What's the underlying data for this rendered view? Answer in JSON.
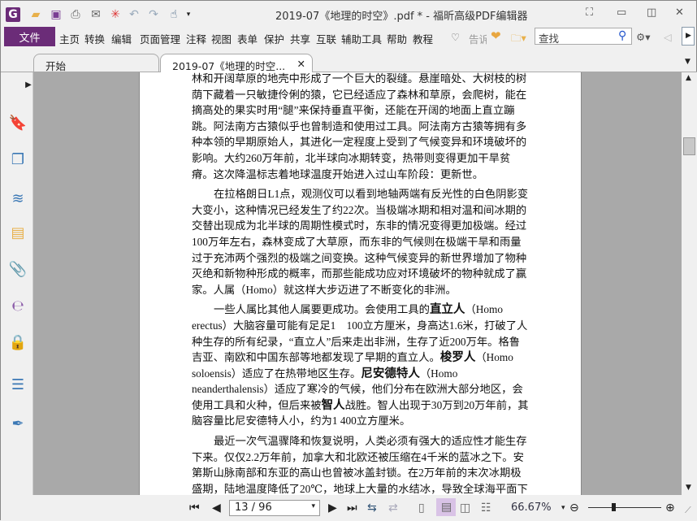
{
  "window": {
    "title": "2019-07《地理的时空》.pdf * - 福昕高级PDF编辑器"
  },
  "menu": {
    "file": "文件",
    "items": [
      "主页",
      "转换",
      "编辑",
      "页面管理",
      "注释",
      "视图",
      "表单",
      "保护",
      "共享",
      "互联",
      "辅助工具",
      "帮助",
      "教程"
    ],
    "tell": "告诉",
    "search_placeholder": "查找"
  },
  "tabs": [
    {
      "label": "开始"
    },
    {
      "label": "2019-07《地理的时空..."
    }
  ],
  "document": {
    "paragraphs": [
      {
        "indent": false,
        "lines": [
          [
            {
              "t": "林和开阔草原的地壳中形成了一个巨大的裂缝。悬崖暗处、大树枝的树"
            }
          ],
          [
            {
              "t": "荫下藏着一只敏捷伶俐的猿，它已经适应了森林和草原，会爬树，能在"
            }
          ],
          [
            {
              "t": "摘高处的果实时用“腿”来保持垂直平衡，还能在开阔的地面上直立蹦"
            }
          ],
          [
            {
              "t": "跳。阿法南方古猿似乎也曾制造和使用过工具。阿法南方古猿等拥有多"
            }
          ],
          [
            {
              "t": "种本领的早期原始人，其进化一定程度上受到了气候变异和环境破坏的"
            }
          ],
          [
            {
              "t": "影响。大约260万年前，北半球向冰期转变，热带则变得更加干旱贫"
            }
          ],
          [
            {
              "t": "瘠。这次降温标志着地球温度开始进入过山车阶段：更新世。"
            }
          ]
        ]
      },
      {
        "indent": true,
        "lines": [
          [
            {
              "t": "在拉格朗日L1点，观测仪可以看到地轴两端有反光性的白色阴影变"
            }
          ],
          [
            {
              "t": "大变小，这种情况已经发生了约22次。当极端冰期和相对温和间冰期的"
            }
          ],
          [
            {
              "t": "交替出现成为北半球的周期性模式时，东非的情况变得更加极端。经过"
            }
          ],
          [
            {
              "t": "100万年左右，森林变成了大草原，而东非的气候则在极端干旱和雨量"
            }
          ],
          [
            {
              "t": "过于充沛两个强烈的极端之间变换。这种气候变异的新世界增加了物种"
            }
          ],
          [
            {
              "t": "灭绝和新物种形成的概率，而那些能成功应对环境破坏的物种就成了赢"
            }
          ],
          [
            {
              "t": "家。人属（Homo）就这样大步迈进了不断变化的非洲。"
            }
          ]
        ]
      },
      {
        "indent": true,
        "lines": [
          [
            {
              "t": "一些人属比其他人属要更成功。会使用工具的"
            },
            {
              "t": "直立人",
              "b": true
            },
            {
              "t": "（Homo"
            }
          ],
          [
            {
              "t": "erectus）大脑容量可能有足足1　100立方厘米，身高达1.6米，打破了人"
            }
          ],
          [
            {
              "t": "种生存的所有纪录，“直立人”后来走出非洲，生存了近200万年。格鲁"
            }
          ],
          [
            {
              "t": "吉亚、南欧和中国东部等地都发现了早期的直立人。"
            },
            {
              "t": "梭罗人",
              "b": true
            },
            {
              "t": "（Homo"
            }
          ],
          [
            {
              "t": "soloensis）适应了在热带地区生存。"
            },
            {
              "t": "尼安德特人",
              "b": true
            },
            {
              "t": "（Homo"
            }
          ],
          [
            {
              "t": "neanderthalensis）适应了寒冷的气候，他们分布在欧洲大部分地区，会"
            }
          ],
          [
            {
              "t": "使用工具和火种，但后来被"
            },
            {
              "t": "智人",
              "b": true
            },
            {
              "t": "战胜。智人出现于30万到20万年前，其"
            }
          ],
          [
            {
              "t": "脑容量比尼安德特人小，约为1 400立方厘米。"
            }
          ]
        ]
      },
      {
        "indent": true,
        "lines": [
          [
            {
              "t": "最近一次气温骤降和恢复说明，人类必须有强大的适应性才能生存"
            }
          ],
          [
            {
              "t": "下来。仅仅2.2万年前，加拿大和北欧还被压缩在4千米的蓝冰之下。安"
            }
          ],
          [
            {
              "t": "第斯山脉南部和东亚的高山也曾被冰盖封锁。在2万年前的末次冰期极"
            }
          ],
          [
            {
              "t": "盛期，陆地温度降低了20℃，地球上大量的水结冰，导致全球海平面下"
            }
          ]
        ]
      }
    ]
  },
  "status": {
    "page": "13 / 96",
    "zoom": "66.67%"
  },
  "colors": {
    "brand": "#6b2c78",
    "active_view": "#d9c3e6"
  }
}
